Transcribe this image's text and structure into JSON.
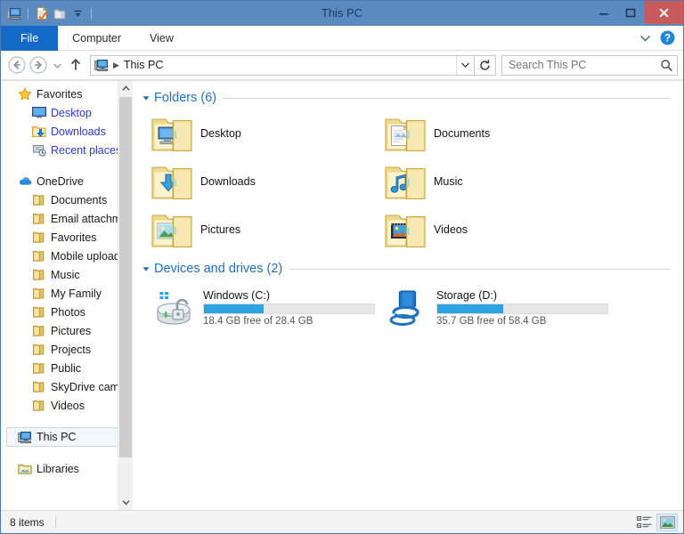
{
  "window": {
    "title": "This PC",
    "accent_color": "#5b8ac1",
    "close_color": "#c75b5b",
    "file_tab_color": "#1569c7"
  },
  "quick_access": [
    {
      "name": "this-pc-icon",
      "label": "This PC"
    },
    {
      "name": "properties-icon",
      "label": "Properties"
    },
    {
      "name": "new-folder-icon",
      "label": "New folder"
    },
    {
      "name": "customize-dropdown-icon",
      "label": "Customize Quick Access Toolbar"
    }
  ],
  "window_controls": {
    "minimize": "Minimize",
    "maximize": "Maximize",
    "close": "Close"
  },
  "ribbon": {
    "tabs": [
      {
        "label": "File",
        "active": true
      },
      {
        "label": "Computer",
        "active": false
      },
      {
        "label": "View",
        "active": false
      }
    ],
    "expand_label": "Expand the Ribbon",
    "help_label": "Help"
  },
  "addressbar": {
    "back_label": "Back",
    "forward_label": "Forward",
    "recent_label": "Recent locations",
    "up_label": "Up",
    "crumb_icon": "this-pc-icon",
    "crumb": "This PC",
    "dropdown_label": "Previous locations",
    "refresh_label": "Refresh",
    "search": {
      "placeholder": "Search This PC",
      "value": ""
    }
  },
  "navpane": {
    "items": [
      {
        "label": "Favorites",
        "icon": "star-icon",
        "level": 0,
        "style": "header",
        "gap_before": false
      },
      {
        "label": "Desktop",
        "icon": "desktop-icon",
        "level": 1,
        "style": "link",
        "gap_before": false
      },
      {
        "label": "Downloads",
        "icon": "downloads-icon",
        "level": 1,
        "style": "link",
        "gap_before": false
      },
      {
        "label": "Recent places",
        "icon": "recent-places-icon",
        "level": 1,
        "style": "link",
        "gap_before": false
      },
      {
        "label": "OneDrive",
        "icon": "onedrive-icon",
        "level": 0,
        "style": "header",
        "gap_before": true
      },
      {
        "label": "Documents",
        "icon": "folder-icon",
        "level": 1,
        "style": "normal",
        "gap_before": false
      },
      {
        "label": "Email attachmen",
        "icon": "folder-icon",
        "level": 1,
        "style": "normal",
        "gap_before": false
      },
      {
        "label": "Favorites",
        "icon": "folder-icon",
        "level": 1,
        "style": "normal",
        "gap_before": false
      },
      {
        "label": "Mobile uploads",
        "icon": "folder-icon",
        "level": 1,
        "style": "normal",
        "gap_before": false
      },
      {
        "label": "Music",
        "icon": "folder-icon",
        "level": 1,
        "style": "normal",
        "gap_before": false
      },
      {
        "label": "My Family",
        "icon": "folder-icon",
        "level": 1,
        "style": "normal",
        "gap_before": false
      },
      {
        "label": "Photos",
        "icon": "folder-icon",
        "level": 1,
        "style": "normal",
        "gap_before": false
      },
      {
        "label": "Pictures",
        "icon": "folder-icon",
        "level": 1,
        "style": "normal",
        "gap_before": false
      },
      {
        "label": "Projects",
        "icon": "folder-icon",
        "level": 1,
        "style": "normal",
        "gap_before": false
      },
      {
        "label": "Public",
        "icon": "folder-icon",
        "level": 1,
        "style": "normal",
        "gap_before": false
      },
      {
        "label": "SkyDrive camera",
        "icon": "folder-icon",
        "level": 1,
        "style": "normal",
        "gap_before": false
      },
      {
        "label": "Videos",
        "icon": "folder-icon",
        "level": 1,
        "style": "normal",
        "gap_before": false
      },
      {
        "label": "This PC",
        "icon": "this-pc-icon",
        "level": 0,
        "style": "selected",
        "gap_before": true
      },
      {
        "label": "Libraries",
        "icon": "libraries-icon",
        "level": 0,
        "style": "header",
        "gap_before": true
      }
    ],
    "scroll_up_label": "Scroll up",
    "scroll_down_label": "Scroll down"
  },
  "content": {
    "groups": [
      {
        "title": "Folders (6)",
        "kind": "folders",
        "items": [
          {
            "label": "Desktop",
            "icon": "folder-desktop-icon"
          },
          {
            "label": "Documents",
            "icon": "folder-documents-icon"
          },
          {
            "label": "Downloads",
            "icon": "folder-downloads-icon"
          },
          {
            "label": "Music",
            "icon": "folder-music-icon"
          },
          {
            "label": "Pictures",
            "icon": "folder-pictures-icon"
          },
          {
            "label": "Videos",
            "icon": "folder-videos-icon"
          }
        ]
      },
      {
        "title": "Devices and drives (2)",
        "kind": "drives",
        "items": [
          {
            "label": "Windows (C:)",
            "icon": "drive-windows-bitlocker-icon",
            "free_text": "18.4 GB free of 28.4 GB",
            "free_gb": 18.4,
            "total_gb": 28.4,
            "used_percent": 35,
            "bar_color": "#2aa3e0"
          },
          {
            "label": "Storage (D:)",
            "icon": "drive-network-icon",
            "free_text": "35.7 GB free of 58.4 GB",
            "free_gb": 35.7,
            "total_gb": 58.4,
            "used_percent": 39,
            "bar_color": "#2aa3e0"
          }
        ]
      }
    ]
  },
  "statusbar": {
    "item_count": "8 items",
    "details_view_label": "Details view",
    "large_icons_view_label": "Large icons view"
  }
}
